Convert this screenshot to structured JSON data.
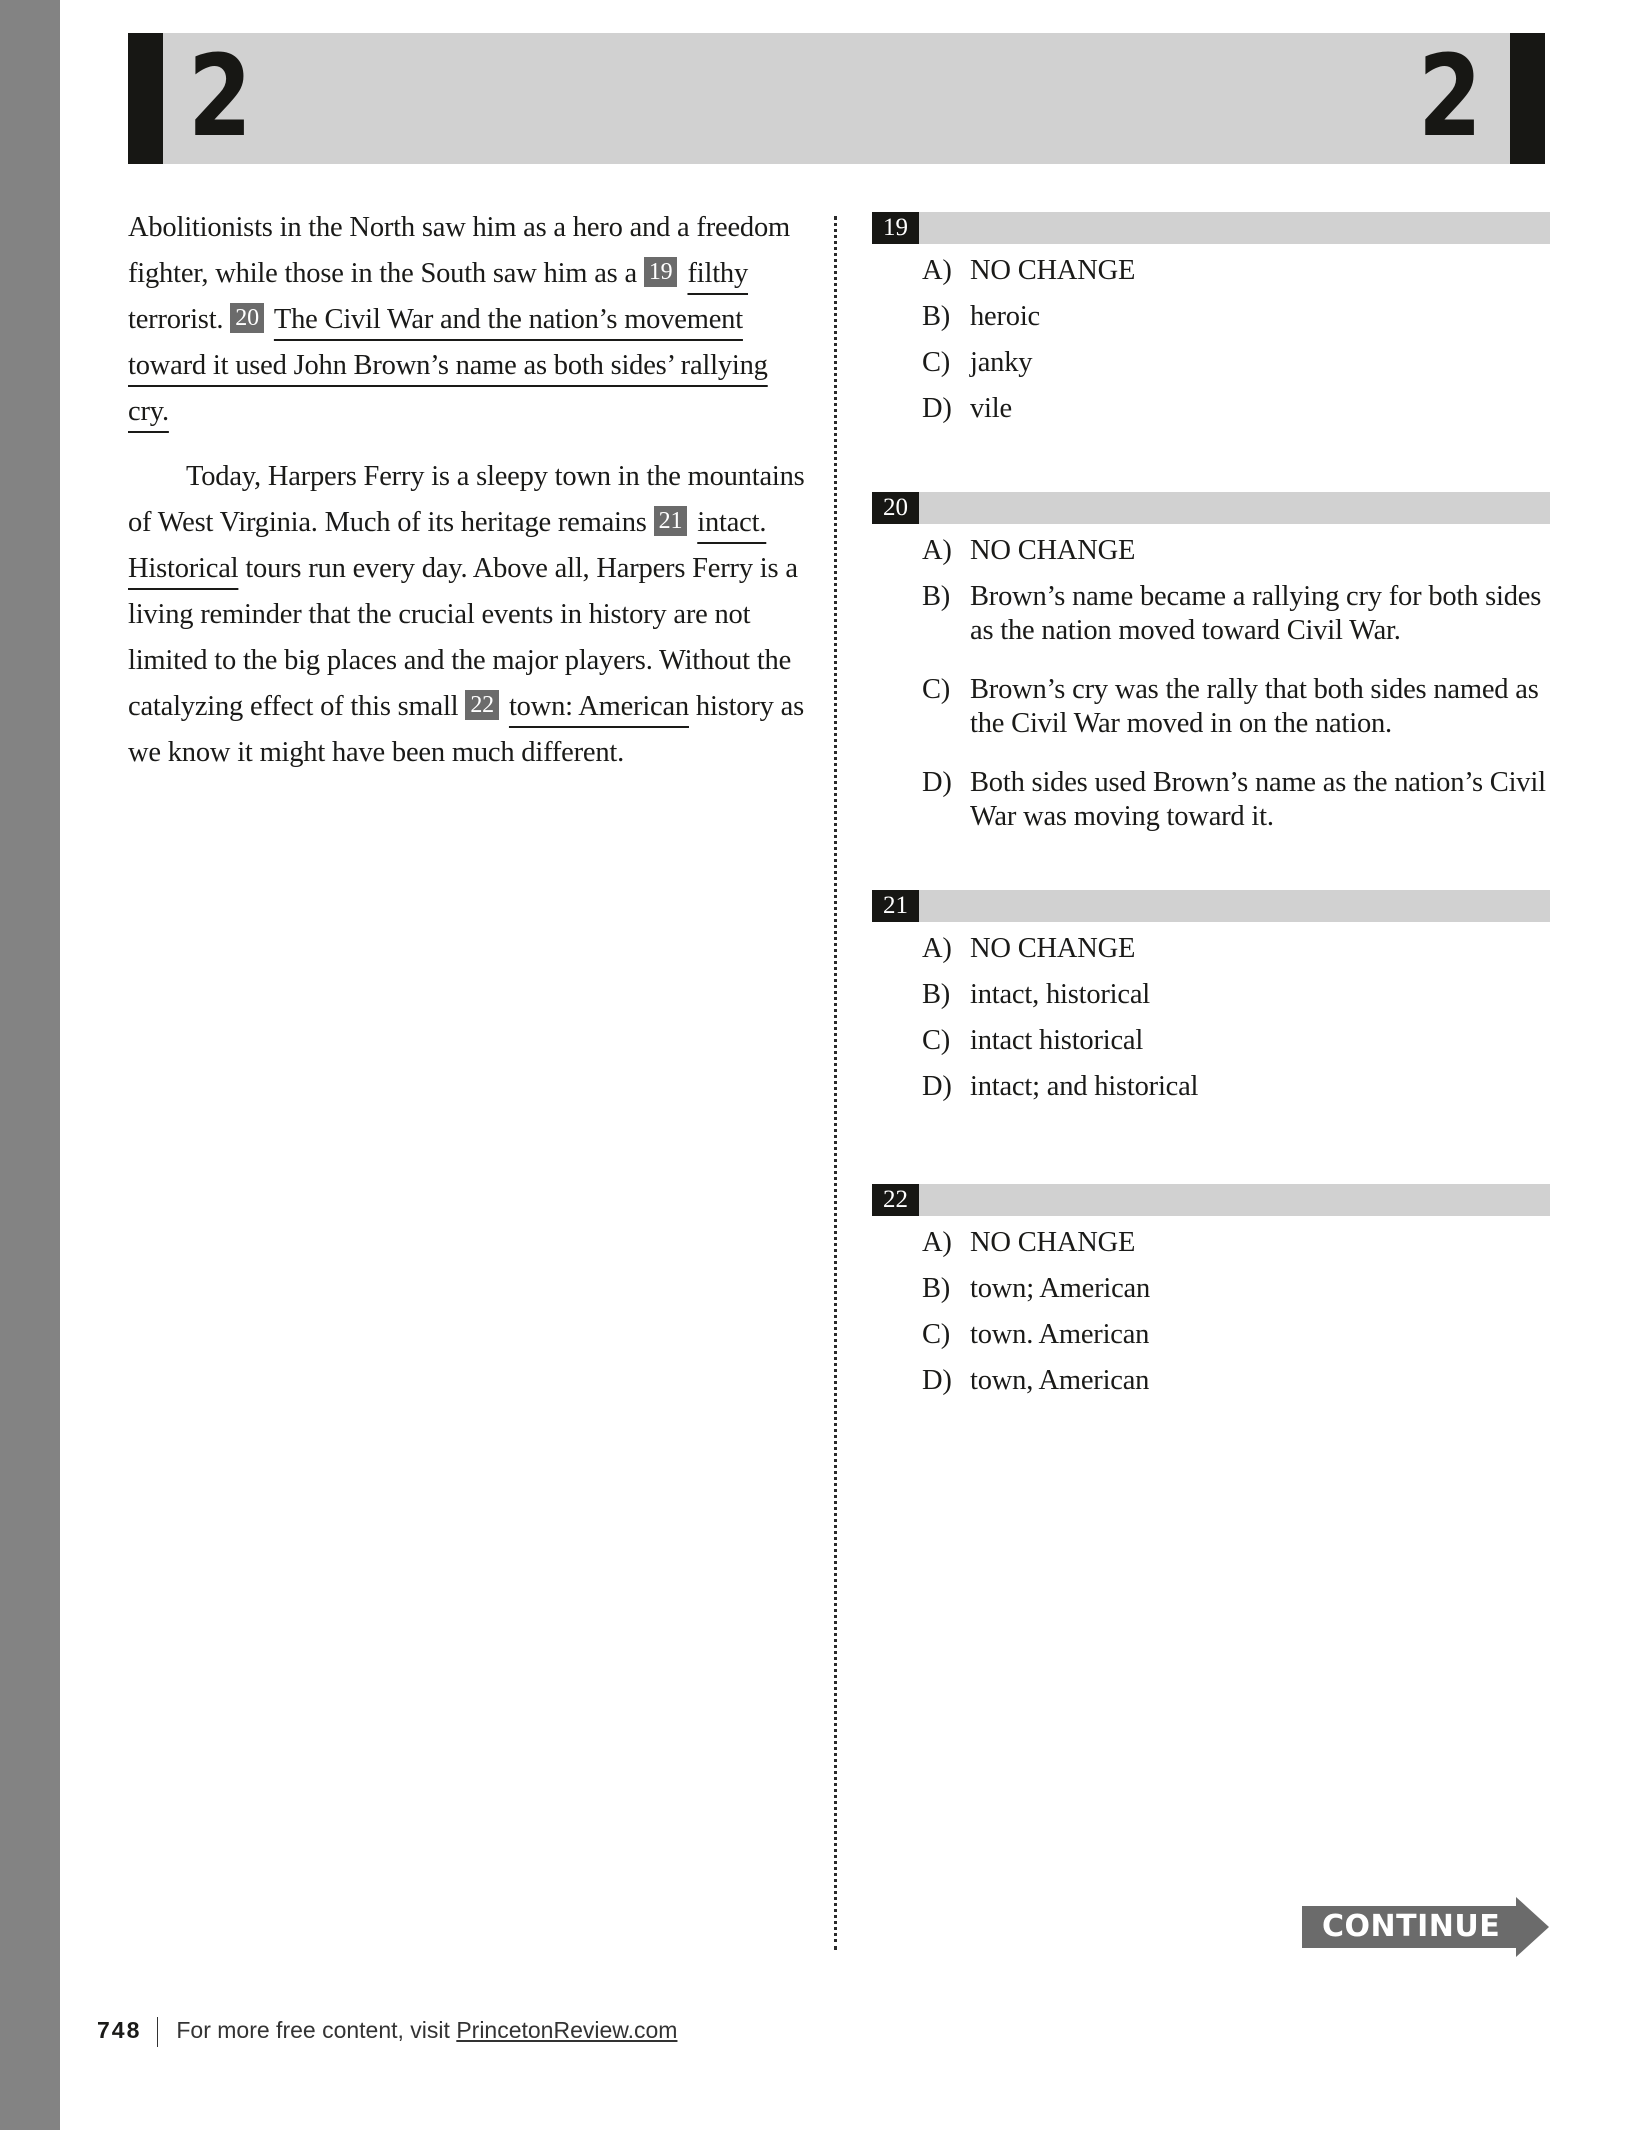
{
  "section_header": {
    "left_number": "2",
    "right_number": "2"
  },
  "passage": {
    "p1": {
      "t1": "Abolitionists in the North saw him as a hero and a freedom fighter, while those in the South saw him as a",
      "q19_marker": "19",
      "q19_text": "filthy",
      "t2": "terrorist.",
      "q20_marker": "20",
      "q20_text": "The Civil War and the nation’s movement toward it used John Brown’s name as both sides’ rallying cry."
    },
    "p2": {
      "t1": "Today, Harpers Ferry is a sleepy town in the mountains of West Virginia. Much of its heritage remains",
      "q21_marker": "21",
      "q21_text": "intact. Historical",
      "t2": "tours run every day. Above all, Harpers Ferry is a living reminder that the crucial events in history are not limited to the big places and the major players. Without the catalyzing effect of this small",
      "q22_marker": "22",
      "q22_text": "town: American",
      "t3": "history as we know it might have been much different."
    }
  },
  "questions": [
    {
      "number": "19",
      "options": [
        {
          "letter": "A)",
          "text": "NO CHANGE"
        },
        {
          "letter": "B)",
          "text": "heroic"
        },
        {
          "letter": "C)",
          "text": "janky"
        },
        {
          "letter": "D)",
          "text": "vile"
        }
      ]
    },
    {
      "number": "20",
      "options": [
        {
          "letter": "A)",
          "text": "NO CHANGE"
        },
        {
          "letter": "B)",
          "text": "Brown’s name became a rallying cry for both sides as the nation moved toward Civil War."
        },
        {
          "letter": "C)",
          "text": "Brown’s cry was the rally that both sides named as the Civil War moved in on the nation."
        },
        {
          "letter": "D)",
          "text": "Both sides used Brown’s name as the nation’s Civil War was moving toward it."
        }
      ]
    },
    {
      "number": "21",
      "options": [
        {
          "letter": "A)",
          "text": "NO CHANGE"
        },
        {
          "letter": "B)",
          "text": "intact, historical"
        },
        {
          "letter": "C)",
          "text": "intact historical"
        },
        {
          "letter": "D)",
          "text": "intact; and historical"
        }
      ]
    },
    {
      "number": "22",
      "options": [
        {
          "letter": "A)",
          "text": "NO CHANGE"
        },
        {
          "letter": "B)",
          "text": "town; American"
        },
        {
          "letter": "C)",
          "text": "town. American"
        },
        {
          "letter": "D)",
          "text": "town, American"
        }
      ]
    }
  ],
  "continue_button": {
    "label": "CONTINUE"
  },
  "footer": {
    "page_number": "748",
    "text": "For more free content, visit ",
    "link_text": "PrincetonReview.com"
  },
  "colors": {
    "sidebar": "#838383",
    "header_band": "#d1d1d1",
    "dark_bar": "#171714",
    "marker_box": "#6b6b6b"
  }
}
